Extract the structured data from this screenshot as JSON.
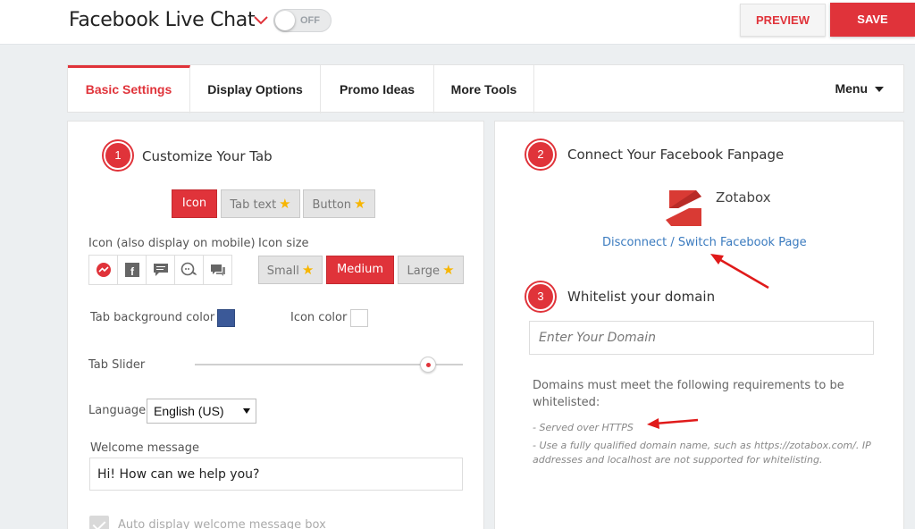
{
  "header": {
    "app_title": "Facebook Live Chat",
    "toggle_state": "OFF",
    "preview_label": "PREVIEW",
    "save_label": "SAVE"
  },
  "tabs": [
    {
      "label": "Basic Settings",
      "active": true
    },
    {
      "label": "Display Options",
      "active": false
    },
    {
      "label": "Promo Ideas",
      "active": false
    },
    {
      "label": "More Tools",
      "active": false
    }
  ],
  "menu_label": "Menu",
  "left_panel": {
    "step_number": "1",
    "title": "Customize Your Tab",
    "tab_type_options": [
      "Icon",
      "Tab text",
      "Button"
    ],
    "tab_type_selected": "Icon",
    "icon_label": "Icon (also display on mobile)",
    "icons": [
      "messenger-icon",
      "facebook-icon",
      "chat-bubble-icon",
      "chat-bubbles-icon",
      "message-icon"
    ],
    "icon_size_label": "Icon size",
    "icon_size_options": [
      "Small",
      "Medium",
      "Large"
    ],
    "icon_size_selected": "Medium",
    "tab_bg_color_label": "Tab background color",
    "tab_bg_color": "#3b5998",
    "icon_color_label": "Icon color",
    "icon_color": "#ffffff",
    "tab_slider_label": "Tab Slider",
    "tab_slider_value": 0.87,
    "language_label": "Language",
    "language_value": "English (US)",
    "welcome_label": "Welcome message",
    "welcome_value": "Hi! How can we help you?",
    "auto_display_label": "Auto display welcome message box"
  },
  "right_panel": {
    "step2_number": "2",
    "step2_title": "Connect Your Facebook Fanpage",
    "page_name": "Zotabox",
    "disconnect_link": "Disconnect / Switch Facebook Page",
    "step3_number": "3",
    "step3_title": "Whitelist your domain",
    "domain_placeholder": "Enter Your Domain",
    "requirements_text": "Domains must meet the following requirements to be whitelisted:",
    "note1": "- Served over HTTPS",
    "note2": "- Use a fully qualified domain name, such as https://zotabox.com/. IP addresses and localhost are not supported for whitelisting."
  },
  "colors": {
    "accent": "#e0333a",
    "link": "#3b7bbf",
    "star": "#f7b500"
  }
}
